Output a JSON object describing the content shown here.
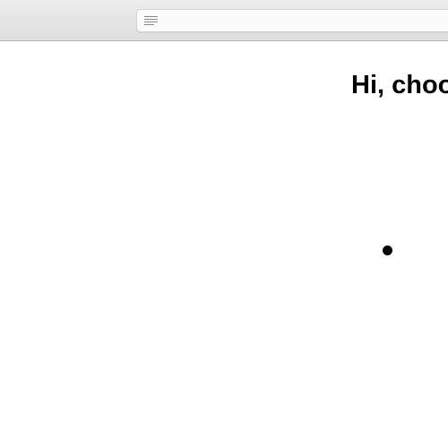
{
  "browser": {
    "address_bar": {
      "url": "",
      "reader_icon": "reader-mode-icon"
    }
  },
  "page": {
    "greeting": "Hi, choo",
    "bullet": "bullet-dot"
  },
  "colors": {
    "toolbar": "#e4e4e4",
    "text": "#000000",
    "background": "#ffffff"
  }
}
